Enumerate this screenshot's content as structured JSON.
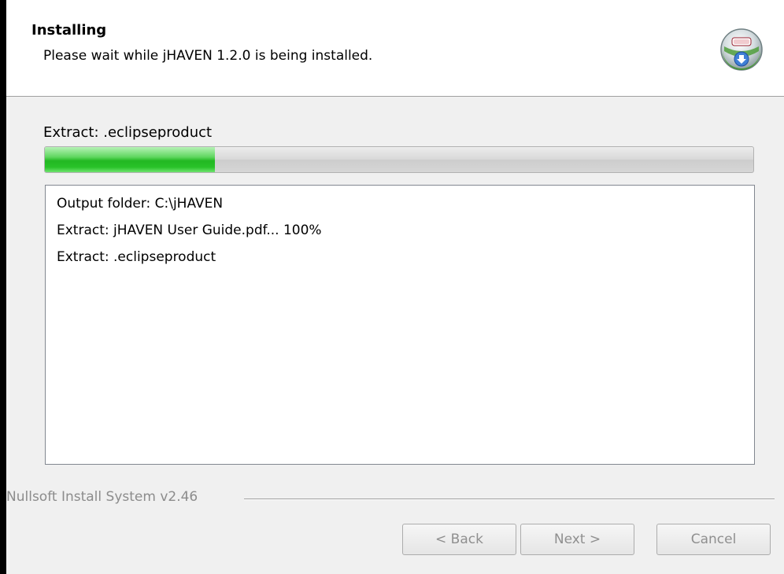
{
  "header": {
    "title": "Installing",
    "subtitle": "Please wait while jHAVEN 1.2.0 is being installed.",
    "icon": "nsis-installer-icon"
  },
  "status": {
    "current_action": "Extract: .eclipseproduct",
    "progress_fraction": 0.24,
    "progress_color": "#22b822"
  },
  "log": {
    "lines": [
      "Output folder: C:\\jHAVEN",
      "Extract: jHAVEN User Guide.pdf... 100%",
      "Extract: .eclipseproduct"
    ]
  },
  "footer": {
    "brand": "Nullsoft Install System v2.46",
    "back_label": "< Back",
    "next_label": "Next >",
    "cancel_label": "Cancel"
  }
}
